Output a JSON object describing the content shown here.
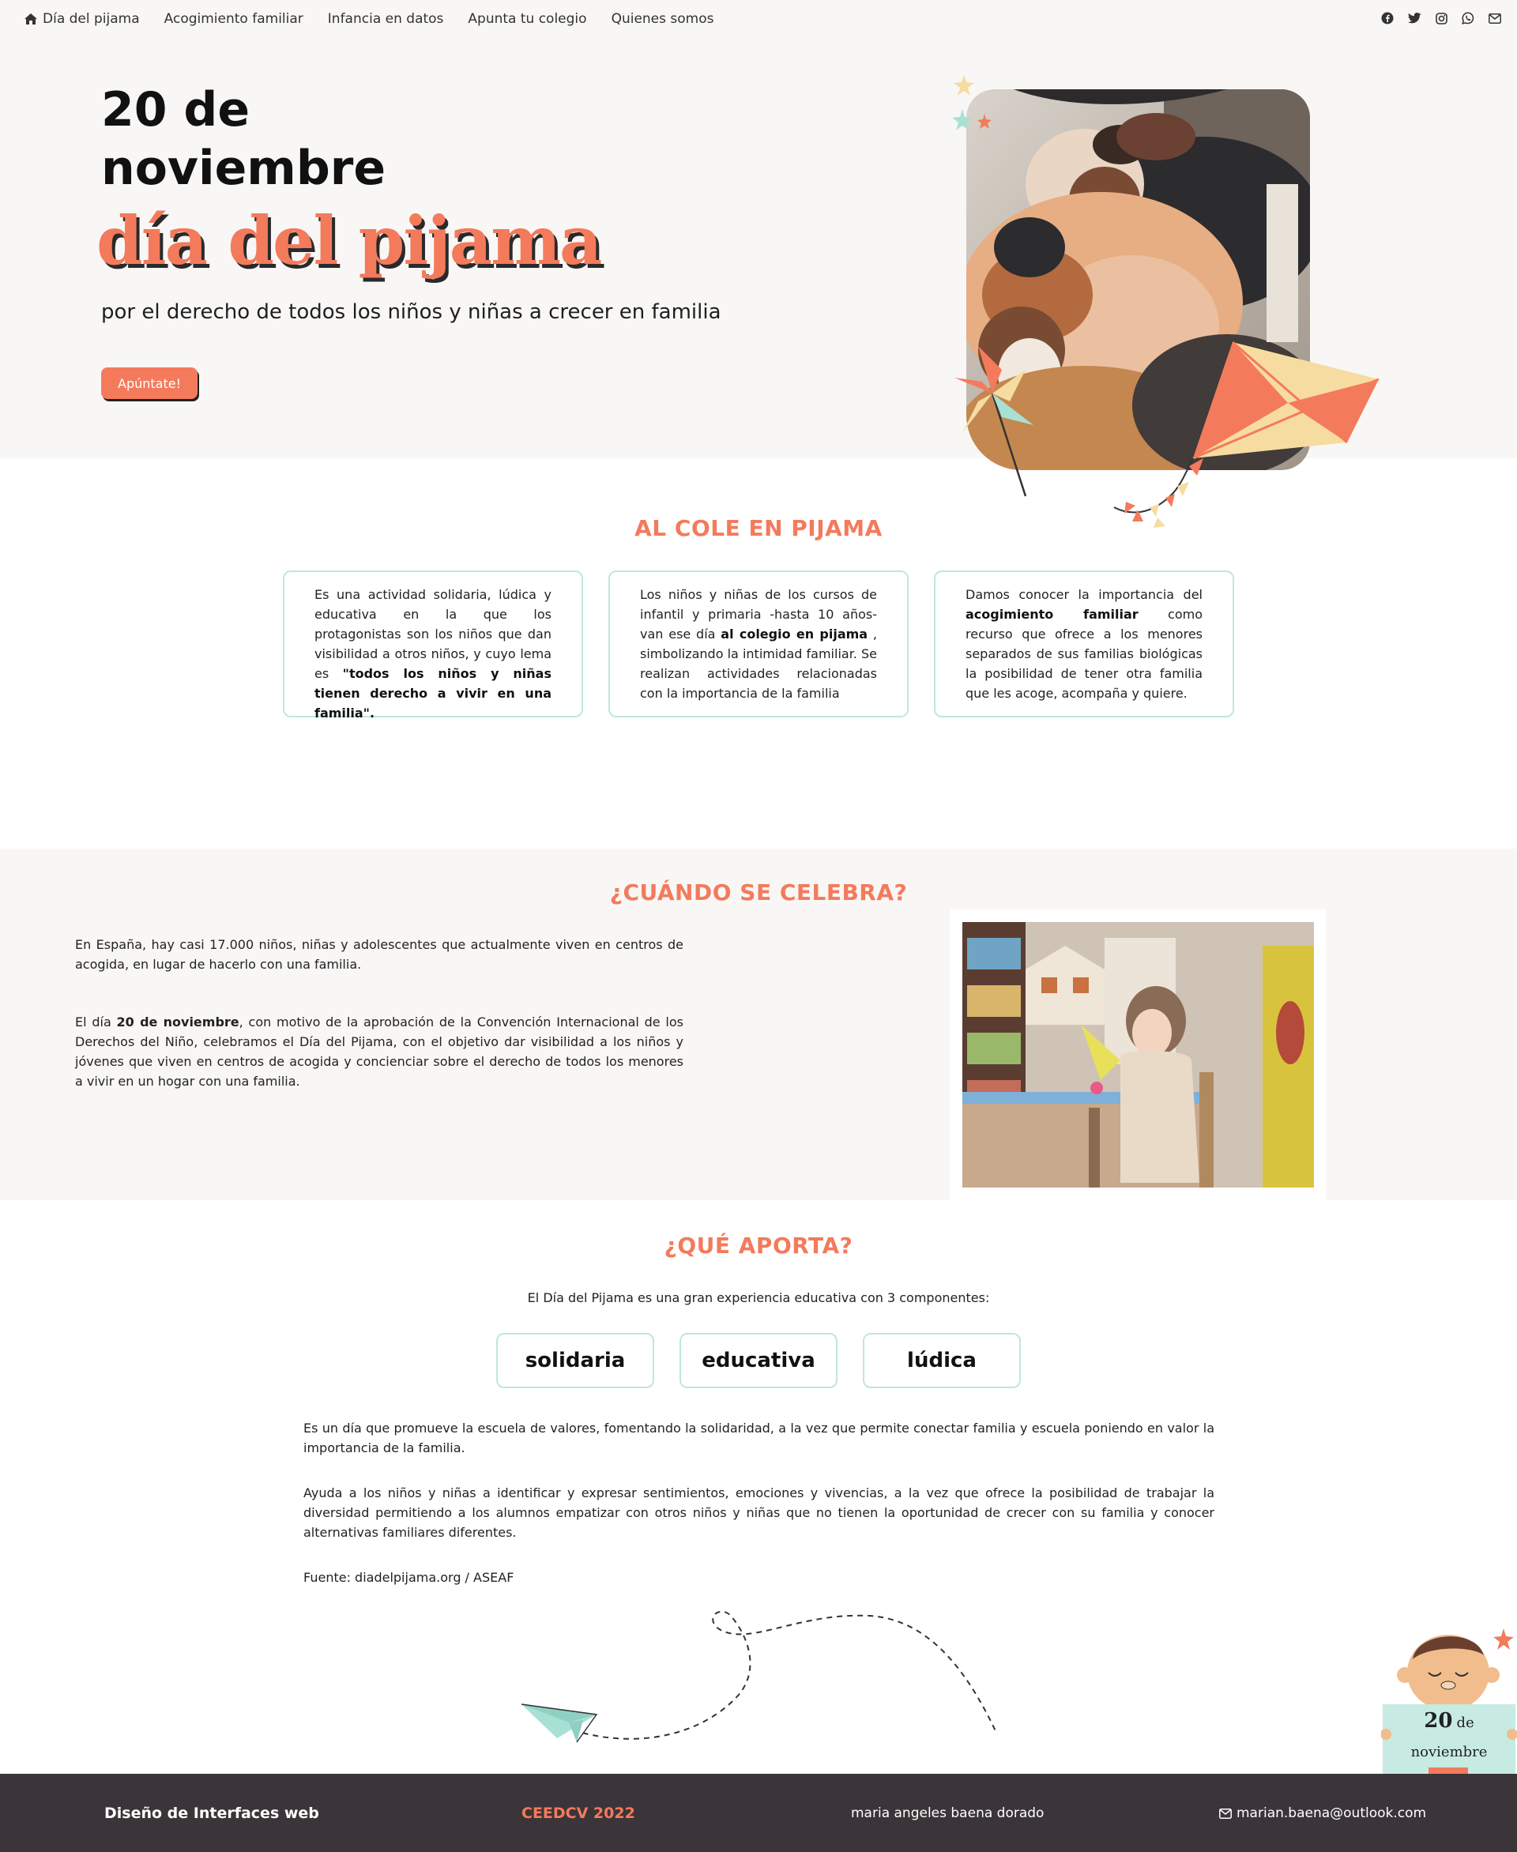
{
  "nav": {
    "links": [
      "Día del pijama",
      "Acogimiento familiar",
      "Infancia en datos",
      "Apunta tu colegio",
      "Quienes somos"
    ],
    "home_icon": "home-icon",
    "social": [
      "facebook-icon",
      "twitter-icon",
      "instagram-icon",
      "whatsapp-icon",
      "mail-icon"
    ]
  },
  "hero": {
    "title_line1": "20 de",
    "title_line2": "noviembre",
    "script": "día del pijama",
    "subtitle": "por el derecho de todos los niños y niñas a crecer en familia",
    "cta": "Apúntate!"
  },
  "cole": {
    "heading": "AL COLE EN PIJAMA",
    "cards": [
      {
        "pre": "Es una actividad solidaria, lúdica y educativa en la que los protagonistas son los niños que dan visibilidad a otros niños, y cuyo lema es ",
        "bold": "\"todos los niños y niñas tienen derecho a vivir en una familia\".",
        "post": ""
      },
      {
        "pre": "Los niños y niñas de los cursos de infantil y primaria -hasta 10 años- van ese día ",
        "bold": "al colegio en pijama",
        "post": " , simbolizando la intimidad familiar. Se realizan actividades relacionadas con la importancia de la familia"
      },
      {
        "pre": "Damos conocer la importancia del ",
        "bold": "acogimiento familiar",
        "post": " como recurso que ofrece a los menores separados de sus familias biológicas la posibilidad de tener otra familia que les acoge, acompaña y quiere."
      }
    ]
  },
  "cuando": {
    "heading": "¿CUÁNDO SE CELEBRA?",
    "p1": "En España, hay casi 17.000 niños, niñas y adolescentes que actualmente viven en centros de acogida, en lugar de hacerlo con una familia.",
    "p2_pre": "El día ",
    "p2_bold": "20 de noviembre",
    "p2_post": ", con motivo de la aprobación de la Convención Internacional de los Derechos del Niño, celebramos el Día del Pijama, con el objetivo dar visibilidad a los niños y jóvenes que viven en centros de acogida y concienciar sobre el derecho de todos los menores a vivir en un hogar con una familia."
  },
  "aporta": {
    "heading": "¿QUÉ APORTA?",
    "intro": "El Día del Pijama es una gran experiencia educativa con 3 componentes:",
    "pills": [
      "solidaria",
      "educativa",
      "lúdica"
    ],
    "p1": "Es un día que promueve la escuela de valores, fomentando la solidaridad, a la vez que permite conectar familia y escuela poniendo en valor la importancia de la familia.",
    "p2": "Ayuda a los niños y niñas a identificar y expresar sentimientos, emociones y vivencias, a la vez que ofrece la posibilidad de trabajar la diversidad permitiendo a los alumnos empatizar con otros niños y niñas que no tienen la oportunidad de crecer con su familia y conocer alternativas familiares diferentes.",
    "source": "Fuente: diadelpijama.org / ASEAF"
  },
  "badge": {
    "num": "20",
    "de": "de",
    "month": "noviembre"
  },
  "footer": {
    "left": "Diseño de Interfaces web",
    "center": "CEEDCV 2022",
    "author": "maria angeles baena dorado",
    "email": "marian.baena@outlook.com"
  },
  "colors": {
    "accent": "#f47a5c",
    "mint": "#bfe7de",
    "bg": "#f8f7f5",
    "footer": "#3b3539"
  }
}
